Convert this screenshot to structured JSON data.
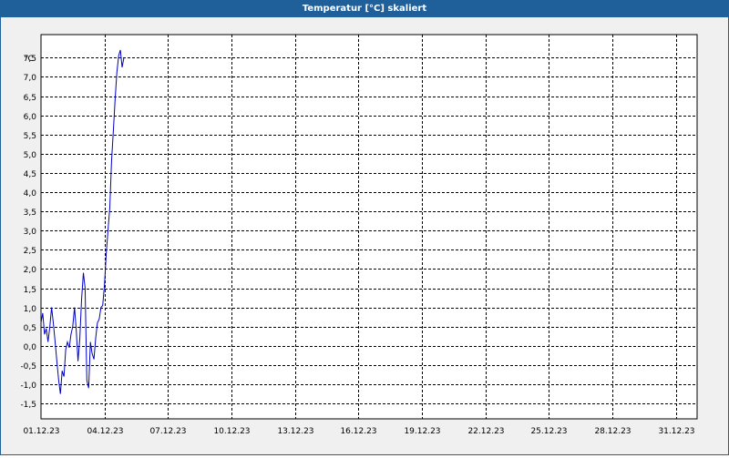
{
  "window": {
    "title": "Temperatur [°C] skaliert"
  },
  "colors": {
    "titlebar": "#1f5f9a",
    "series": "#0000c8",
    "grid": "#000000"
  },
  "chart_data": {
    "type": "line",
    "ylabel": "°C",
    "ylim": [
      -1.9,
      8.1
    ],
    "yticks": [
      -1.5,
      -1.0,
      -0.5,
      0.0,
      0.5,
      1.0,
      1.5,
      2.0,
      2.5,
      3.0,
      3.5,
      4.0,
      4.5,
      5.0,
      5.5,
      6.0,
      6.5,
      7.0,
      7.5
    ],
    "ytick_labels": [
      "-1,5",
      "-1,0",
      "-0,5",
      "0,0",
      "0,5",
      "1,0",
      "1,5",
      "2,0",
      "2,5",
      "3,0",
      "3,5",
      "4,0",
      "4,5",
      "5,0",
      "5,5",
      "6,0",
      "6,5",
      "7,0",
      "7,5"
    ],
    "xlim": [
      "2023-12-01",
      "2024-01-01"
    ],
    "xtick_labels": [
      "01.12.23",
      "04.12.23",
      "07.12.23",
      "10.12.23",
      "13.12.23",
      "16.12.23",
      "19.12.23",
      "22.12.23",
      "25.12.23",
      "28.12.23",
      "31.12.23"
    ],
    "xticks": [
      "2023-12-01",
      "2023-12-04",
      "2023-12-07",
      "2023-12-10",
      "2023-12-13",
      "2023-12-16",
      "2023-12-19",
      "2023-12-22",
      "2023-12-25",
      "2023-12-28",
      "2023-12-31"
    ],
    "grid": true,
    "series": [
      {
        "x": [
          "2023-12-01 00:00",
          "2023-12-01 02:00",
          "2023-12-01 04:00",
          "2023-12-01 06:00",
          "2023-12-01 08:00",
          "2023-12-01 10:00",
          "2023-12-01 12:00",
          "2023-12-01 14:00",
          "2023-12-01 16:00",
          "2023-12-01 18:00",
          "2023-12-01 20:00",
          "2023-12-01 22:00",
          "2023-12-02 00:00",
          "2023-12-02 02:00",
          "2023-12-02 04:00",
          "2023-12-02 06:00",
          "2023-12-02 08:00",
          "2023-12-02 10:00",
          "2023-12-02 12:00",
          "2023-12-02 14:00",
          "2023-12-02 16:00",
          "2023-12-02 18:00",
          "2023-12-02 20:00",
          "2023-12-02 22:00",
          "2023-12-03 00:00",
          "2023-12-03 02:00",
          "2023-12-03 04:00",
          "2023-12-03 06:00",
          "2023-12-03 08:00",
          "2023-12-03 10:00",
          "2023-12-03 12:00",
          "2023-12-03 14:00",
          "2023-12-03 16:00",
          "2023-12-03 18:00",
          "2023-12-03 20:00",
          "2023-12-03 22:00",
          "2023-12-04 00:00",
          "2023-12-04 02:00",
          "2023-12-04 04:00",
          "2023-12-04 06:00",
          "2023-12-04 08:00",
          "2023-12-04 10:00",
          "2023-12-04 12:00",
          "2023-12-04 14:00",
          "2023-12-04 16:00",
          "2023-12-04 18:00",
          "2023-12-04 20:00",
          "2023-12-04 22:00",
          "2023-12-05 00:00",
          "2023-12-05 02:00",
          "2023-12-05 04:00",
          "2023-12-05 06:00",
          "2023-12-05 08:00",
          "2023-12-05 10:00",
          "2023-12-05 12:00",
          "2023-12-05 14:00",
          "2023-12-05 16:00",
          "2023-12-05 18:00",
          "2023-12-05 20:00",
          "2023-12-05 22:00",
          "2023-12-06 00:00",
          "2023-12-06 02:00"
        ],
        "y": [
          0.6,
          0.85,
          0.3,
          0.45,
          0.1,
          0.5,
          1.0,
          0.6,
          0.1,
          -0.4,
          -0.9,
          -1.25,
          -0.65,
          -0.8,
          -0.1,
          0.1,
          -0.05,
          0.3,
          0.5,
          1.0,
          0.4,
          -0.4,
          0.2,
          1.2,
          1.9,
          1.5,
          -0.9,
          -1.1,
          0.1,
          -0.2,
          -0.35,
          0.2,
          0.6,
          0.7,
          1.0,
          1.05,
          1.6,
          2.4,
          3.0,
          3.6,
          4.8,
          5.6,
          6.4,
          7.1,
          7.55,
          7.7,
          7.25,
          7.5,
          null,
          null,
          null,
          null,
          null,
          null,
          null,
          null,
          null,
          null,
          null,
          null,
          null,
          null
        ]
      }
    ]
  }
}
